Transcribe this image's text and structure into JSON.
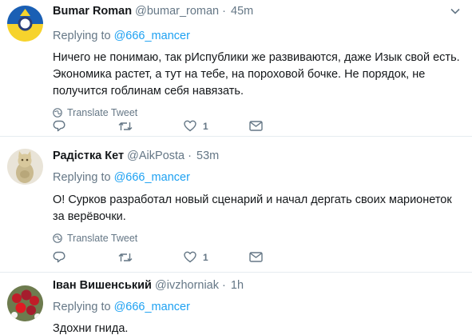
{
  "tweets": [
    {
      "name": "Bumar Roman",
      "handle": "@bumar_roman",
      "dot": "·",
      "time": "45m",
      "replying_prefix": "Replying to",
      "replying_to": "@666_mancer",
      "text": "Ничего не понимаю, так рИспублики же развиваются, даже Изык свой есть. Экономика растет, а тут на тебе, на пороховой бочке. Не порядок, не получится гоблинам себя навязать.",
      "translate_label": "Translate Tweet",
      "likes": "1",
      "icons": [
        "reply-icon",
        "retweet-icon",
        "like-icon",
        "message-icon"
      ]
    },
    {
      "name": "Радістка Кет",
      "handle": "@AikPosta",
      "dot": "·",
      "time": "53m",
      "replying_prefix": "Replying to",
      "replying_to": "@666_mancer",
      "text": "О! Сурков разработал новый сценарий  и начал дергать своих марионеток за верёвочки.",
      "translate_label": "Translate Tweet",
      "likes": "1",
      "icons": [
        "reply-icon",
        "retweet-icon",
        "like-icon",
        "message-icon"
      ]
    },
    {
      "name": "Іван Вишенський",
      "handle": "@ivzhorniak",
      "dot": "·",
      "time": "1h",
      "replying_prefix": "Replying to",
      "replying_to": "@666_mancer",
      "text": "Здохни гнида."
    }
  ],
  "colors": {
    "accent": "#1da1f2",
    "muted": "#657786",
    "text": "#14171a",
    "divider": "#e6ecf0"
  }
}
